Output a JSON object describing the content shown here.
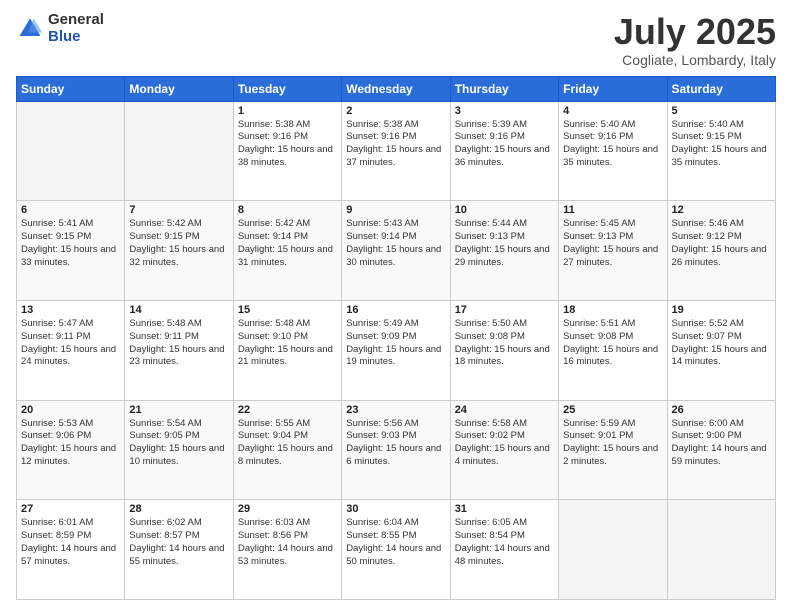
{
  "header": {
    "logo_general": "General",
    "logo_blue": "Blue",
    "month": "July 2025",
    "location": "Cogliate, Lombardy, Italy"
  },
  "weekdays": [
    "Sunday",
    "Monday",
    "Tuesday",
    "Wednesday",
    "Thursday",
    "Friday",
    "Saturday"
  ],
  "weeks": [
    [
      {
        "day": "",
        "empty": true
      },
      {
        "day": "",
        "empty": true
      },
      {
        "day": "1",
        "sunrise": "5:38 AM",
        "sunset": "9:16 PM",
        "daylight": "15 hours and 38 minutes."
      },
      {
        "day": "2",
        "sunrise": "5:38 AM",
        "sunset": "9:16 PM",
        "daylight": "15 hours and 37 minutes."
      },
      {
        "day": "3",
        "sunrise": "5:39 AM",
        "sunset": "9:16 PM",
        "daylight": "15 hours and 36 minutes."
      },
      {
        "day": "4",
        "sunrise": "5:40 AM",
        "sunset": "9:16 PM",
        "daylight": "15 hours and 35 minutes."
      },
      {
        "day": "5",
        "sunrise": "5:40 AM",
        "sunset": "9:15 PM",
        "daylight": "15 hours and 35 minutes."
      }
    ],
    [
      {
        "day": "6",
        "sunrise": "5:41 AM",
        "sunset": "9:15 PM",
        "daylight": "15 hours and 33 minutes."
      },
      {
        "day": "7",
        "sunrise": "5:42 AM",
        "sunset": "9:15 PM",
        "daylight": "15 hours and 32 minutes."
      },
      {
        "day": "8",
        "sunrise": "5:42 AM",
        "sunset": "9:14 PM",
        "daylight": "15 hours and 31 minutes."
      },
      {
        "day": "9",
        "sunrise": "5:43 AM",
        "sunset": "9:14 PM",
        "daylight": "15 hours and 30 minutes."
      },
      {
        "day": "10",
        "sunrise": "5:44 AM",
        "sunset": "9:13 PM",
        "daylight": "15 hours and 29 minutes."
      },
      {
        "day": "11",
        "sunrise": "5:45 AM",
        "sunset": "9:13 PM",
        "daylight": "15 hours and 27 minutes."
      },
      {
        "day": "12",
        "sunrise": "5:46 AM",
        "sunset": "9:12 PM",
        "daylight": "15 hours and 26 minutes."
      }
    ],
    [
      {
        "day": "13",
        "sunrise": "5:47 AM",
        "sunset": "9:11 PM",
        "daylight": "15 hours and 24 minutes."
      },
      {
        "day": "14",
        "sunrise": "5:48 AM",
        "sunset": "9:11 PM",
        "daylight": "15 hours and 23 minutes."
      },
      {
        "day": "15",
        "sunrise": "5:48 AM",
        "sunset": "9:10 PM",
        "daylight": "15 hours and 21 minutes."
      },
      {
        "day": "16",
        "sunrise": "5:49 AM",
        "sunset": "9:09 PM",
        "daylight": "15 hours and 19 minutes."
      },
      {
        "day": "17",
        "sunrise": "5:50 AM",
        "sunset": "9:08 PM",
        "daylight": "15 hours and 18 minutes."
      },
      {
        "day": "18",
        "sunrise": "5:51 AM",
        "sunset": "9:08 PM",
        "daylight": "15 hours and 16 minutes."
      },
      {
        "day": "19",
        "sunrise": "5:52 AM",
        "sunset": "9:07 PM",
        "daylight": "15 hours and 14 minutes."
      }
    ],
    [
      {
        "day": "20",
        "sunrise": "5:53 AM",
        "sunset": "9:06 PM",
        "daylight": "15 hours and 12 minutes."
      },
      {
        "day": "21",
        "sunrise": "5:54 AM",
        "sunset": "9:05 PM",
        "daylight": "15 hours and 10 minutes."
      },
      {
        "day": "22",
        "sunrise": "5:55 AM",
        "sunset": "9:04 PM",
        "daylight": "15 hours and 8 minutes."
      },
      {
        "day": "23",
        "sunrise": "5:56 AM",
        "sunset": "9:03 PM",
        "daylight": "15 hours and 6 minutes."
      },
      {
        "day": "24",
        "sunrise": "5:58 AM",
        "sunset": "9:02 PM",
        "daylight": "15 hours and 4 minutes."
      },
      {
        "day": "25",
        "sunrise": "5:59 AM",
        "sunset": "9:01 PM",
        "daylight": "15 hours and 2 minutes."
      },
      {
        "day": "26",
        "sunrise": "6:00 AM",
        "sunset": "9:00 PM",
        "daylight": "14 hours and 59 minutes."
      }
    ],
    [
      {
        "day": "27",
        "sunrise": "6:01 AM",
        "sunset": "8:59 PM",
        "daylight": "14 hours and 57 minutes."
      },
      {
        "day": "28",
        "sunrise": "6:02 AM",
        "sunset": "8:57 PM",
        "daylight": "14 hours and 55 minutes."
      },
      {
        "day": "29",
        "sunrise": "6:03 AM",
        "sunset": "8:56 PM",
        "daylight": "14 hours and 53 minutes."
      },
      {
        "day": "30",
        "sunrise": "6:04 AM",
        "sunset": "8:55 PM",
        "daylight": "14 hours and 50 minutes."
      },
      {
        "day": "31",
        "sunrise": "6:05 AM",
        "sunset": "8:54 PM",
        "daylight": "14 hours and 48 minutes."
      },
      {
        "day": "",
        "empty": true
      },
      {
        "day": "",
        "empty": true
      }
    ]
  ]
}
